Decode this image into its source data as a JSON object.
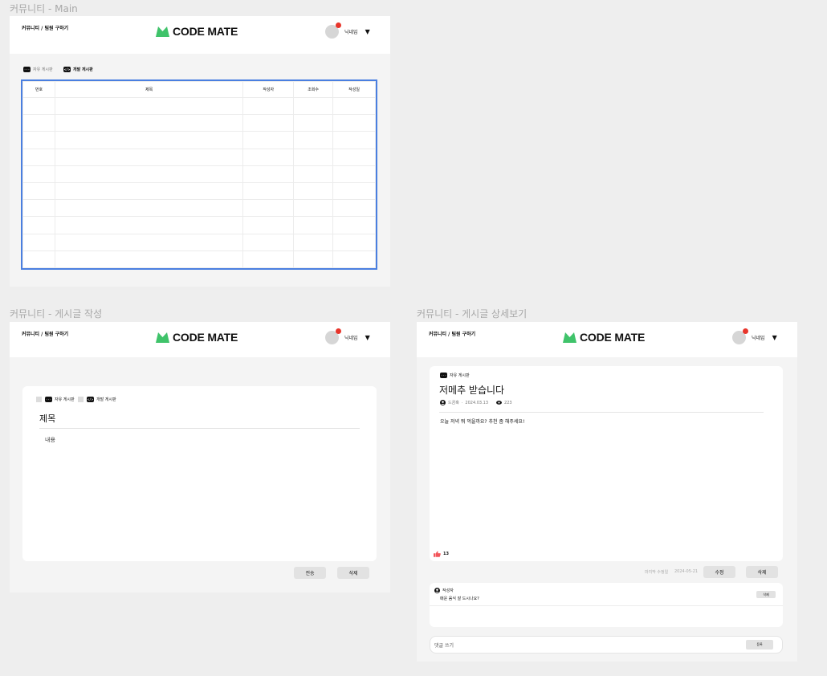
{
  "frames": {
    "main_label": "커뮤니티 - Main",
    "write_label": "커뮤니티 - 게시글 작성",
    "detail_label": "커뮤니티 - 게시글  상세보기"
  },
  "header": {
    "nav": "커뮤니티 / 팀원 구하기",
    "logo": "CODE MATE",
    "nickname": "닉네임",
    "caret": "▼"
  },
  "main": {
    "tabs": [
      {
        "label": "자유 게시판",
        "icon": "chat-bubble-icon"
      },
      {
        "label": "개발 게시판",
        "icon": "code-icon"
      }
    ],
    "columns": [
      "번호",
      "제목",
      "작성자",
      "조회수",
      "작성일"
    ]
  },
  "write": {
    "tabs": [
      {
        "label": "자유 게시판",
        "icon": "chat-bubble-icon"
      },
      {
        "label": "개발 게시판",
        "icon": "code-icon"
      }
    ],
    "title_placeholder": "제목",
    "content_placeholder": "내용",
    "submit": "전송",
    "delete": "삭제"
  },
  "detail": {
    "board": "자유 게시판",
    "title": "저메추 받습니다",
    "author": "드곰혹",
    "date": "2024.03.13",
    "views": "223",
    "body": "오늘 저녁 뭐 먹을까요? 추천 좀 해주세요!",
    "likes": "13",
    "edited_label": "마지막 수정일",
    "edited_date": "2024-05-21",
    "edit": "수정",
    "delete": "삭제",
    "comment": {
      "author": "작성자",
      "text": "매운 음식 잘 드시나요?",
      "delete": "삭제"
    },
    "comment_placeholder": "댓글 쓰기",
    "register": "등록"
  },
  "colors": {
    "brand": "#3fc36a",
    "selection": "#4a7fe0",
    "notification": "#e8352b",
    "like": "#f2555a"
  }
}
